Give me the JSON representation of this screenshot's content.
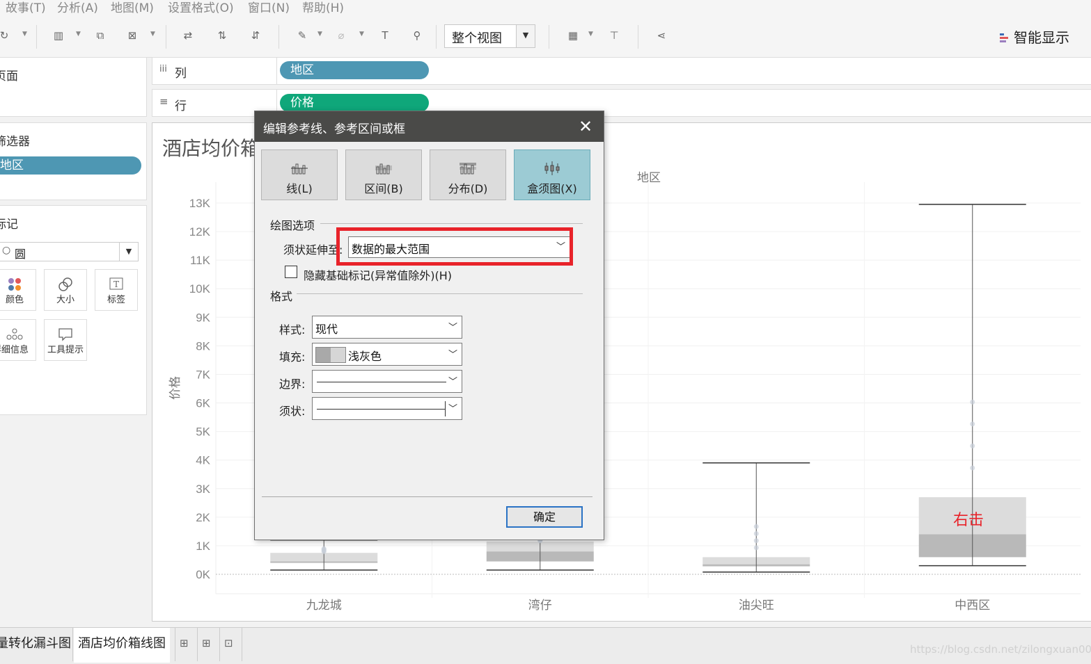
{
  "menu": [
    "故事(T)",
    "分析(A)",
    "地图(M)",
    "设置格式(O)",
    "窗口(N)",
    "帮助(H)"
  ],
  "toolbar": {
    "view_select": "整个视图",
    "show_me": "智能显示",
    "show_me_colors": [
      "#3c6ab5",
      "#e15759",
      "#9b7fbf"
    ]
  },
  "left": {
    "pages_title": "页面",
    "filters_title": "筛选器",
    "filter_pill": "地区",
    "marks_title": "标记",
    "mark_type": "圆",
    "mark_buttons": [
      {
        "label": "颜色",
        "icon": "color-dots-icon"
      },
      {
        "label": "大小",
        "icon": "size-icon"
      },
      {
        "label": "标签",
        "icon": "label-icon"
      },
      {
        "label": "详细信息",
        "icon": "detail-icon"
      },
      {
        "label": "工具提示",
        "icon": "tooltip-icon"
      }
    ]
  },
  "shelves": {
    "columns_label": "列",
    "columns_pill": "地区",
    "rows_label": "行",
    "rows_pill": "价格"
  },
  "chart": {
    "title_visible": "酒店均价箱",
    "annotation": "右击"
  },
  "chart_data": {
    "type": "box",
    "xlabel": "地区",
    "ylabel": "价格",
    "categories": [
      "九龙城",
      "湾仔",
      "油尖旺",
      "中西区"
    ],
    "y_ticks": [
      "0K",
      "1K",
      "2K",
      "3K",
      "4K",
      "5K",
      "6K",
      "7K",
      "8K",
      "9K",
      "10K",
      "11K",
      "12K",
      "13K"
    ],
    "ylim": [
      0,
      13000
    ],
    "boxes": [
      {
        "category": "九龙城",
        "min": 150,
        "q1": 400,
        "median": 450,
        "q3": 750,
        "max": 1200
      },
      {
        "category": "湾仔",
        "min": 150,
        "q1": 450,
        "median": 800,
        "q3": 1150,
        "max": 1400
      },
      {
        "category": "油尖旺",
        "min": 80,
        "q1": 280,
        "median": 350,
        "q3": 600,
        "max": 3900
      },
      {
        "category": "中西区",
        "min": 300,
        "q1": 600,
        "median": 1400,
        "q3": 2700,
        "max": 12950
      }
    ],
    "fill": "#d4d4d4",
    "whisker_color": "#555555"
  },
  "dialog": {
    "title": "编辑参考线、参考区间或框",
    "tabs": [
      {
        "label": "线(L)",
        "active": false
      },
      {
        "label": "区间(B)",
        "active": false
      },
      {
        "label": "分布(D)",
        "active": false
      },
      {
        "label": "盒须图(X)",
        "active": true
      }
    ],
    "plot_options_title": "绘图选项",
    "whisker_label": "须状延伸至:",
    "whisker_value": "数据的最大范围",
    "hide_marks_label": "隐藏基础标记(异常值除外)(H)",
    "hide_marks_checked": false,
    "format_title": "格式",
    "style_label": "样式:",
    "style_value": "现代",
    "fill_label": "填充:",
    "fill_value": "浅灰色",
    "border_label": "边界:",
    "whisker_fmt_label": "须状:",
    "ok_label": "确定",
    "highlight_color": "#e8232a"
  },
  "tabs": {
    "sheets": [
      "量转化漏斗图",
      "酒店均价箱线图"
    ],
    "active_index": 1
  },
  "watermark": "https://blog.csdn.net/zilongxuan008"
}
